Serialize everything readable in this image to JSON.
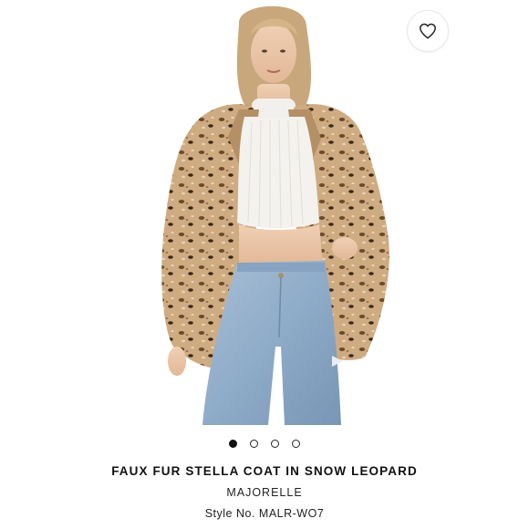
{
  "product": {
    "title": "FAUX FUR STELLA COAT IN SNOW LEOPARD",
    "brand": "MAJORELLE",
    "style_number": "Style No. MALR-WO7"
  },
  "favorite": {
    "icon": "heart-outline-icon"
  },
  "carousel": {
    "total_slides": 4,
    "active_index": 0
  },
  "colors": {
    "background": "#ffffff",
    "text": "#111111",
    "coat": "#c9a47c",
    "jeans": "#9fb7cf",
    "top": "#f4f2ee"
  }
}
